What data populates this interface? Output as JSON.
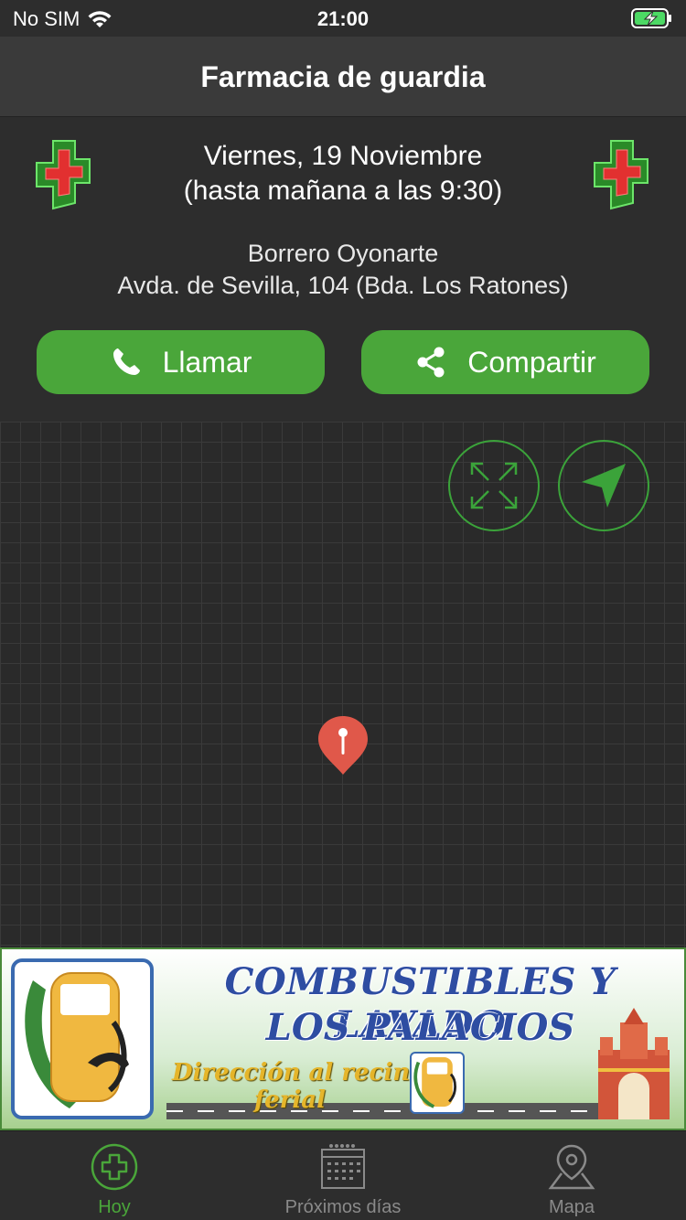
{
  "status": {
    "carrier": "No SIM",
    "time": "21:00"
  },
  "nav": {
    "title": "Farmacia de guardia"
  },
  "duty": {
    "date": "Viernes, 19 Noviembre",
    "until": "(hasta mañana a las 9:30)",
    "pharmacy_name": "Borrero Oyonarte",
    "address": "Avda. de Sevilla, 104 (Bda. Los Ratones)"
  },
  "actions": {
    "call_label": "Llamar",
    "share_label": "Compartir"
  },
  "map": {
    "expand_icon": "expand-icon",
    "locate_icon": "navigation-arrow-icon",
    "pin_icon": "map-pin-icon"
  },
  "ad": {
    "title_line1": "COMBUSTIBLES Y LAVADO",
    "title_line2": "LOS PALACIOS",
    "subtitle_line1": "Dirección al recinto",
    "subtitle_line2": "ferial"
  },
  "tabs": [
    {
      "label": "Hoy",
      "icon": "cross-circle-icon",
      "active": true
    },
    {
      "label": "Próximos días",
      "icon": "calendar-icon",
      "active": false
    },
    {
      "label": "Mapa",
      "icon": "map-location-icon",
      "active": false
    }
  ],
  "colors": {
    "accent_green": "#4aa63a",
    "background": "#2d2d2d",
    "pin_red": "#e0584a",
    "tab_inactive": "#8a8a8a"
  }
}
